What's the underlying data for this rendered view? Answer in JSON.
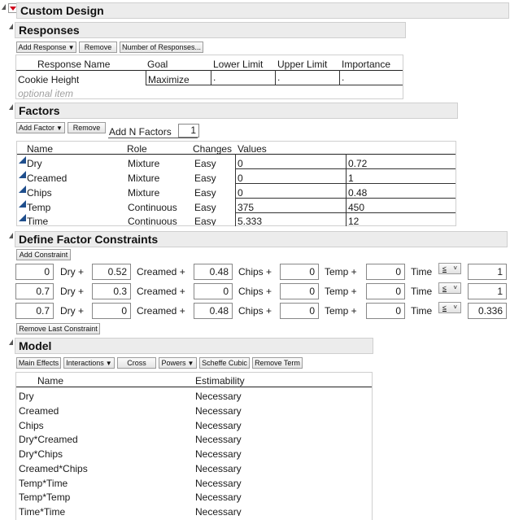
{
  "platform": {
    "title": "Custom Design"
  },
  "responses": {
    "title": "Responses",
    "buttons": {
      "add": "Add Response",
      "remove": "Remove",
      "number": "Number of Responses..."
    },
    "columns": [
      "Response Name",
      "Goal",
      "Lower Limit",
      "Upper Limit",
      "Importance"
    ],
    "rows": [
      {
        "name": "Cookie Height",
        "goal": "Maximize",
        "lower": ".",
        "upper": ".",
        "importance": "."
      }
    ],
    "optional_placeholder": "optional item"
  },
  "factors": {
    "title": "Factors",
    "buttons": {
      "add": "Add Factor",
      "remove": "Remove"
    },
    "add_n_label": "Add N Factors",
    "add_n_value": "1",
    "columns": [
      "Name",
      "Role",
      "Changes",
      "Values"
    ],
    "rows": [
      {
        "name": "Dry",
        "role": "Mixture",
        "changes": "Easy",
        "low": "0",
        "high": "0.72"
      },
      {
        "name": "Creamed",
        "role": "Mixture",
        "changes": "Easy",
        "low": "0",
        "high": "1"
      },
      {
        "name": "Chips",
        "role": "Mixture",
        "changes": "Easy",
        "low": "0",
        "high": "0.48"
      },
      {
        "name": "Temp",
        "role": "Continuous",
        "changes": "Easy",
        "low": "375",
        "high": "450"
      },
      {
        "name": "Time",
        "role": "Continuous",
        "changes": "Easy",
        "low": "5.333",
        "high": "12"
      }
    ]
  },
  "constraints": {
    "title": "Define Factor Constraints",
    "add_button": "Add Constraint",
    "remove_last_button": "Remove Last Constraint",
    "term_labels": [
      "Dry +",
      "Creamed +",
      "Chips +",
      "Temp +",
      "Time"
    ],
    "relation": "≤",
    "rows": [
      {
        "coefs": [
          "0",
          "0.52",
          "0.48",
          "0",
          "0"
        ],
        "rhs": "1"
      },
      {
        "coefs": [
          "0.7",
          "0.3",
          "0",
          "0",
          "0"
        ],
        "rhs": "1"
      },
      {
        "coefs": [
          "0.7",
          "0",
          "0.48",
          "0",
          "0"
        ],
        "rhs": "0.336"
      }
    ]
  },
  "model": {
    "title": "Model",
    "buttons": {
      "main": "Main Effects",
      "interactions": "Interactions",
      "cross": "Cross",
      "powers": "Powers",
      "scheffe": "Scheffe Cubic",
      "remove": "Remove Term"
    },
    "columns": [
      "Name",
      "Estimability"
    ],
    "rows": [
      {
        "name": "Dry",
        "est": "Necessary"
      },
      {
        "name": "Creamed",
        "est": "Necessary"
      },
      {
        "name": "Chips",
        "est": "Necessary"
      },
      {
        "name": "Dry*Creamed",
        "est": "Necessary"
      },
      {
        "name": "Dry*Chips",
        "est": "Necessary"
      },
      {
        "name": "Creamed*Chips",
        "est": "Necessary"
      },
      {
        "name": "Temp*Time",
        "est": "Necessary"
      },
      {
        "name": "Temp*Temp",
        "est": "Necessary"
      },
      {
        "name": "Time*Time",
        "est": "Necessary"
      }
    ]
  },
  "colors": {
    "header_bg": "#ececec",
    "red_menu": "#d0021b",
    "factor_triangle": "#1f4e8c"
  }
}
